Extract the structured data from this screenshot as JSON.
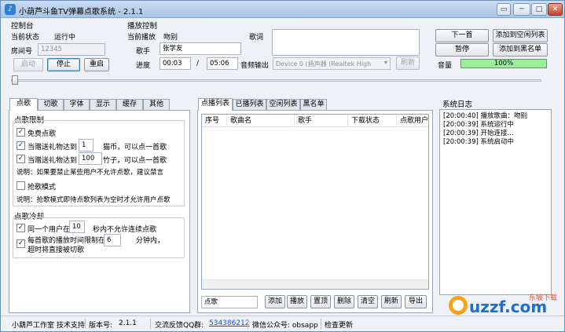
{
  "window": {
    "title": "小葫芦斗鱼TV弹幕点歌系统 - 2.1.1",
    "minimize": "─",
    "maximize": "□",
    "close": "✕",
    "extra": "▭"
  },
  "control": {
    "title": "控制台",
    "state_label": "当前状态",
    "state_value": "运行中",
    "room_label": "房间号",
    "room_value": "12345",
    "start": "启动",
    "stop": "停止",
    "restart": "重启"
  },
  "play": {
    "title": "播放控制",
    "current_label": "当前播放",
    "current_value": "吻别",
    "lyrics_label": "歌词",
    "singer_label": "歌手",
    "singer_value": "张学友",
    "progress_label": "进度",
    "progress_current": "00:03",
    "progress_sep": "/",
    "progress_total": "05:06",
    "audio_label": "音频输出",
    "audio_value": "Device 0 (扬声器 (Realtek High",
    "refresh": "刷新"
  },
  "right_buttons": {
    "next": "下一首",
    "add_idle": "添加到空闲列表",
    "pause": "暂停",
    "add_black": "添加到黑名单",
    "volume_label": "音量",
    "volume_value": "100%"
  },
  "left_tabs": [
    "点歌",
    "切歌",
    "字体",
    "显示",
    "缓存",
    "其他"
  ],
  "limits": {
    "title": "点歌限制",
    "free": "免费点歌",
    "gift1_a": "当赠送礼物达到",
    "gift1_val": "1",
    "gift1_b": "猫币，可以点一首歌",
    "gift2_a": "当赠送礼物达到",
    "gift2_val": "100",
    "gift2_b": "竹子，可以点一首歌",
    "note1": "说明：如果要禁止某些用户不允许点歌，建议禁言",
    "grab": "抢歌模式",
    "note2": "说明：抢歌模式即待点歌列表为空时才允许用户点歌"
  },
  "cooldown": {
    "title": "点歌冷却",
    "same_user_a": "同一个用户在",
    "same_user_val": "10",
    "same_user_b": "秒内不允许连续点歌",
    "limit_a": "每首歌的播放时间限制在",
    "limit_b": "超时将直接被切歌",
    "limit_val": "6",
    "limit_c": "分钟内，"
  },
  "list_tabs": [
    "点播列表",
    "已播列表",
    "空闲列表",
    "黑名单"
  ],
  "list_columns": [
    "序号",
    "歌曲名",
    "歌手",
    "下载状态",
    "点歌用户"
  ],
  "list_bottom": {
    "search_value": "点歌",
    "add": "添加",
    "play": "播放",
    "top": "置顶",
    "delete": "删除",
    "clear": "清空",
    "refresh": "刷新",
    "export": "导出"
  },
  "log": {
    "title": "系统日志",
    "lines": [
      "[20:00:40] 播放歌曲：吻别",
      "[20:00:39] 系统运行中",
      "[20:00:39] 开始连接...",
      "[20:00:39] 系统启动中"
    ]
  },
  "status": {
    "studio": "小葫芦工作室 技术支持",
    "version_label": "版本号:",
    "version": "2.1.1",
    "qq_label": "交流反馈QQ群:",
    "qq": "534386212",
    "wechat": "微信公众号: obsapp",
    "update": "检查更新"
  },
  "watermark": {
    "text": "uzzf.com",
    "sub": "东坡下载"
  },
  "colors": {
    "volume_fill": "#9bf09b",
    "link": "#1a4fd6",
    "title_bar": "#b8cfea"
  }
}
